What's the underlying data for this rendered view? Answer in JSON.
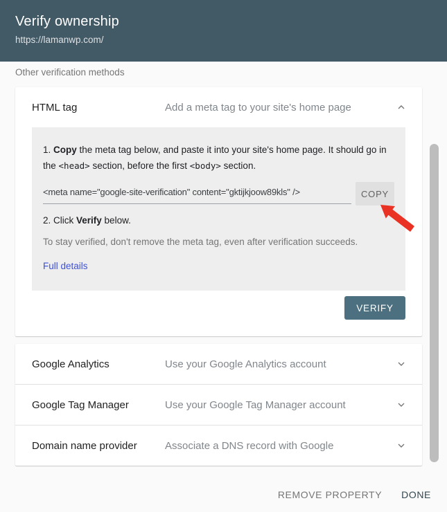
{
  "header": {
    "title": "Verify ownership",
    "url": "https://lamanwp.com/"
  },
  "section_label": "Other verification methods",
  "html_tag_panel": {
    "title": "HTML tag",
    "subtitle": "Add a meta tag to your site's home page",
    "step1_num": "1. ",
    "step1_bold": "Copy",
    "step1_a": " the meta tag below, and paste it into your site's home page. It should go in the ",
    "head_tag": "<head>",
    "step1_b": " section, before the first ",
    "body_tag": "<body>",
    "step1_c": " section.",
    "meta_tag": "<meta name=\"google-site-verification\" content=\"gktijkjoow89kls\" />",
    "copy_label": "COPY",
    "step2_a": "2. Click ",
    "step2_bold": "Verify",
    "step2_b": " below.",
    "note": "To stay verified, don't remove the meta tag, even after verification succeeds.",
    "details_link": "Full details",
    "verify_label": "VERIFY"
  },
  "methods": [
    {
      "title": "Google Analytics",
      "subtitle": "Use your Google Analytics account"
    },
    {
      "title": "Google Tag Manager",
      "subtitle": "Use your Google Tag Manager account"
    },
    {
      "title": "Domain name provider",
      "subtitle": "Associate a DNS record with Google"
    }
  ],
  "footer": {
    "remove_label": "REMOVE PROPERTY",
    "done_label": "DONE"
  },
  "icons": {
    "panel_open": "chevron-up",
    "panel_closed": "chevron-down",
    "annotation": "red-arrow"
  },
  "colors": {
    "header_bg": "#425966",
    "verify_button": "#4d7080",
    "link": "#3d51d8",
    "instruction_bg": "#eeeeee",
    "arrow": "#e93223",
    "copy_button_bg": "#e0e0e0"
  }
}
